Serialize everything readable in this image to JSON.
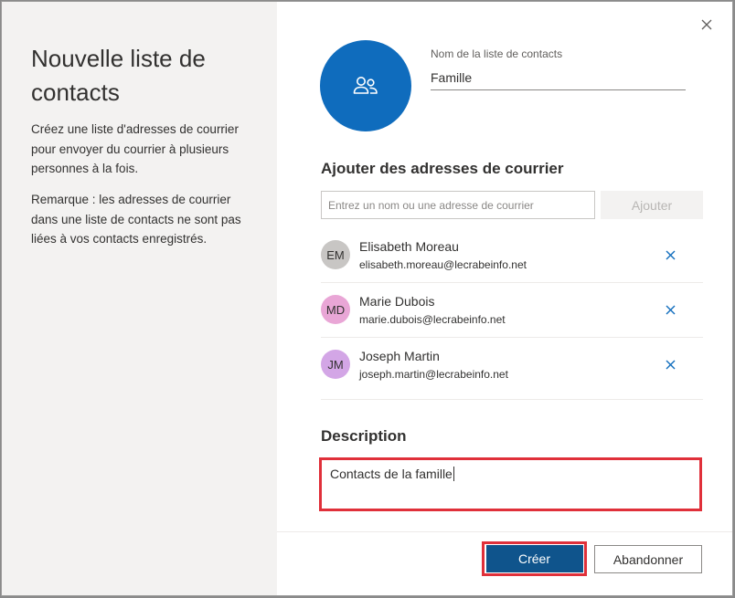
{
  "left_panel": {
    "title": "Nouvelle liste de contacts",
    "intro": "Créez une liste d'adresses de courrier pour envoyer du courrier à plusieurs personnes à la fois.",
    "note": "Remarque : les adresses de courrier dans une liste de contacts ne sont pas liées à vos contacts enregistrés."
  },
  "list_name": {
    "label": "Nom de la liste de contacts",
    "value": "Famille"
  },
  "add_section": {
    "title": "Ajouter des adresses de courrier",
    "placeholder": "Entrez un nom ou une adresse de courrier",
    "add_label": "Ajouter"
  },
  "contacts": [
    {
      "initials": "EM",
      "name": "Elisabeth Moreau",
      "email": "elisabeth.moreau@lecrabeinfo.net",
      "color": "#c8c6c4",
      "icon": "close-icon"
    },
    {
      "initials": "MD",
      "name": "Marie Dubois",
      "email": "marie.dubois@lecrabeinfo.net",
      "color": "#e9a6d6",
      "icon": "close-icon"
    },
    {
      "initials": "JM",
      "name": "Joseph Martin",
      "email": "joseph.martin@lecrabeinfo.net",
      "color": "#d3a6e6",
      "icon": "close-icon"
    }
  ],
  "description": {
    "title": "Description",
    "value": "Contacts de la famille"
  },
  "footer": {
    "create_label": "Créer",
    "cancel_label": "Abandonner"
  },
  "colors": {
    "accent": "#0f6cbd",
    "primary_button": "#0f548c",
    "highlight": "#e0303a"
  },
  "icons": {
    "close": "close-icon",
    "group": "people-icon"
  }
}
